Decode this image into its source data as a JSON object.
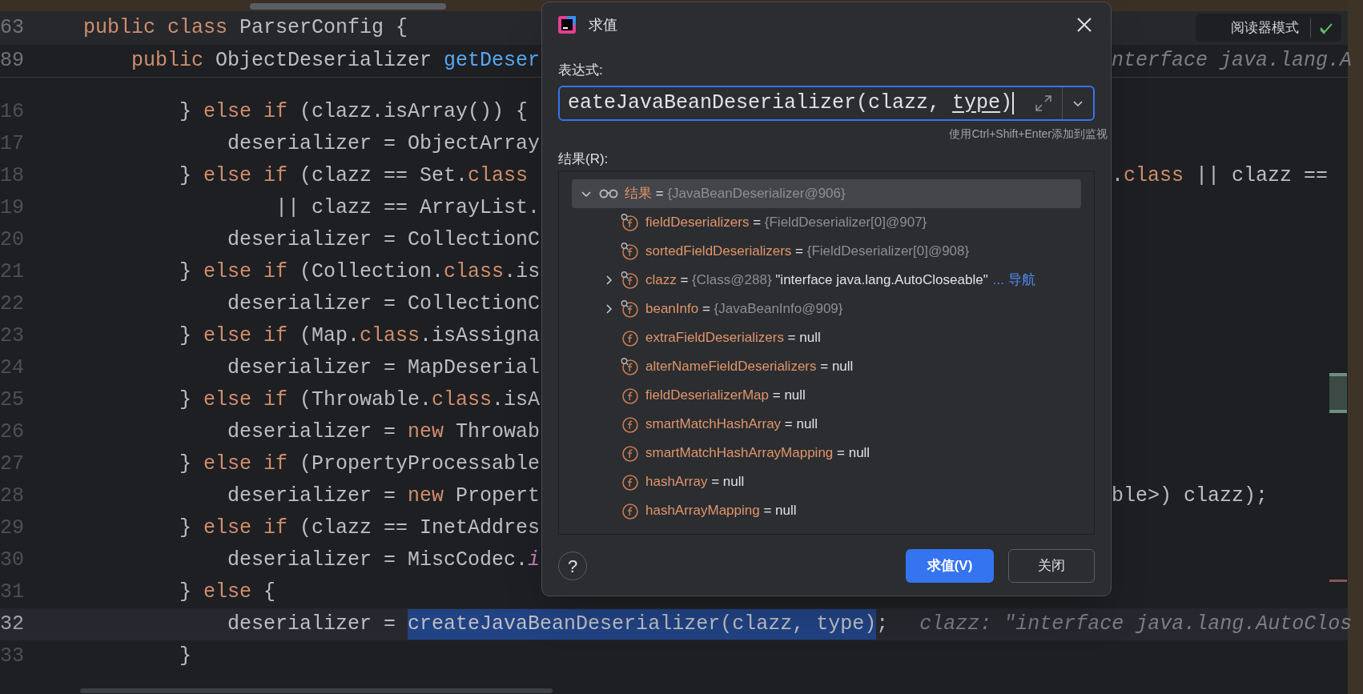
{
  "editor": {
    "sticky_lines": [
      {
        "number": "63",
        "tokens": [
          {
            "text": "public class",
            "kind": "keyword"
          },
          {
            "text": " ParserConfig {",
            "kind": "plain"
          }
        ]
      },
      {
        "number": "89",
        "tokens": [
          {
            "text": "    public",
            "kind": "keyword"
          },
          {
            "text": " ObjectDeserializer ",
            "kind": "plain"
          },
          {
            "text": "getDeser",
            "kind": "method"
          }
        ],
        "right_tokens": [
          {
            "text": "nterface java.lang.A",
            "kind": "hint"
          }
        ]
      }
    ],
    "reader_mode": {
      "label": "阅读器模式"
    },
    "lines": [
      {
        "number": "16",
        "current": false,
        "tokens": [
          {
            "text": "        } ",
            "kind": "plain"
          },
          {
            "text": "else if",
            "kind": "keyword"
          },
          {
            "text": " (clazz.isArray()) {",
            "kind": "plain"
          }
        ]
      },
      {
        "number": "17",
        "current": false,
        "tokens": [
          {
            "text": "            deserializer = ObjectArray",
            "kind": "plain"
          }
        ]
      },
      {
        "number": "18",
        "current": false,
        "tokens": [
          {
            "text": "        } ",
            "kind": "plain"
          },
          {
            "text": "else if",
            "kind": "keyword"
          },
          {
            "text": " (clazz == Set.",
            "kind": "plain"
          },
          {
            "text": "class",
            "kind": "keyword"
          }
        ],
        "right_tokens": [
          {
            "text": ".",
            "kind": "plain"
          },
          {
            "text": "class",
            "kind": "keyword"
          },
          {
            "text": " || clazz ==",
            "kind": "plain"
          }
        ]
      },
      {
        "number": "19",
        "current": false,
        "tokens": [
          {
            "text": "                || clazz == ArrayList.",
            "kind": "plain"
          }
        ]
      },
      {
        "number": "20",
        "current": false,
        "tokens": [
          {
            "text": "            deserializer = CollectionC",
            "kind": "plain"
          }
        ]
      },
      {
        "number": "21",
        "current": false,
        "tokens": [
          {
            "text": "        } ",
            "kind": "plain"
          },
          {
            "text": "else if",
            "kind": "keyword"
          },
          {
            "text": " (Collection.",
            "kind": "plain"
          },
          {
            "text": "class",
            "kind": "keyword"
          },
          {
            "text": ".is",
            "kind": "plain"
          }
        ]
      },
      {
        "number": "22",
        "current": false,
        "tokens": [
          {
            "text": "            deserializer = CollectionC",
            "kind": "plain"
          }
        ]
      },
      {
        "number": "23",
        "current": false,
        "tokens": [
          {
            "text": "        } ",
            "kind": "plain"
          },
          {
            "text": "else if",
            "kind": "keyword"
          },
          {
            "text": " (Map.",
            "kind": "plain"
          },
          {
            "text": "class",
            "kind": "keyword"
          },
          {
            "text": ".isAssigna",
            "kind": "plain"
          }
        ]
      },
      {
        "number": "24",
        "current": false,
        "tokens": [
          {
            "text": "            deserializer = MapDeserial",
            "kind": "plain"
          }
        ]
      },
      {
        "number": "25",
        "current": false,
        "tokens": [
          {
            "text": "        } ",
            "kind": "plain"
          },
          {
            "text": "else if",
            "kind": "keyword"
          },
          {
            "text": " (Throwable.",
            "kind": "plain"
          },
          {
            "text": "class",
            "kind": "keyword"
          },
          {
            "text": ".isA",
            "kind": "plain"
          }
        ]
      },
      {
        "number": "26",
        "current": false,
        "tokens": [
          {
            "text": "            deserializer = ",
            "kind": "plain"
          },
          {
            "text": "new",
            "kind": "keyword"
          },
          {
            "text": " Throwab",
            "kind": "plain"
          }
        ]
      },
      {
        "number": "27",
        "current": false,
        "tokens": [
          {
            "text": "        } ",
            "kind": "plain"
          },
          {
            "text": "else if",
            "kind": "keyword"
          },
          {
            "text": " (PropertyProcessable",
            "kind": "plain"
          }
        ]
      },
      {
        "number": "28",
        "current": false,
        "tokens": [
          {
            "text": "            deserializer = ",
            "kind": "plain"
          },
          {
            "text": "new",
            "kind": "keyword"
          },
          {
            "text": " Propert",
            "kind": "plain"
          }
        ],
        "right_tokens": [
          {
            "text": "ble>) clazz);",
            "kind": "plain"
          }
        ]
      },
      {
        "number": "29",
        "current": false,
        "tokens": [
          {
            "text": "        } ",
            "kind": "plain"
          },
          {
            "text": "else if",
            "kind": "keyword"
          },
          {
            "text": " (clazz == InetAddres",
            "kind": "plain"
          }
        ]
      },
      {
        "number": "30",
        "current": false,
        "tokens": [
          {
            "text": "            deserializer = MiscCodec.",
            "kind": "plain"
          },
          {
            "text": "i",
            "kind": "static"
          }
        ]
      },
      {
        "number": "31",
        "current": false,
        "tokens": [
          {
            "text": "        } ",
            "kind": "plain"
          },
          {
            "text": "else",
            "kind": "keyword"
          },
          {
            "text": " {",
            "kind": "plain"
          }
        ]
      },
      {
        "number": "32",
        "current": true,
        "tokens": [
          {
            "text": "            deserializer = ",
            "kind": "plain"
          },
          {
            "text": "createJavaBeanDeserializer(clazz, type)",
            "kind": "selected"
          },
          {
            "text": ";",
            "kind": "plain"
          },
          {
            "text": "clazz: \"interface java.lang.AutoClos",
            "kind": "hint"
          }
        ]
      },
      {
        "number": "33",
        "current": false,
        "tokens": [
          {
            "text": "        }",
            "kind": "plain"
          }
        ]
      }
    ]
  },
  "dialog": {
    "title": "求值",
    "expression_label": "表达式:",
    "expression": [
      {
        "text": "eateJavaBeanDeserializer(clazz, ",
        "kind": "plain"
      },
      {
        "text": "type",
        "kind": "underlined"
      },
      {
        "text": ")",
        "kind": "plain"
      }
    ],
    "hint": "使用Ctrl+Shift+Enter添加到监视",
    "result_label": "结果(R):",
    "result_tree": {
      "name": "结果",
      "op": "=",
      "value": "{JavaBeanDeserializer@906}",
      "expanded": true,
      "selected": true,
      "children": [
        {
          "name": "fieldDeserializers",
          "op": "=",
          "marked": true,
          "expandable": false,
          "value": [
            {
              "text": "{FieldDeserializer[0]@907}",
              "kind": "ref"
            }
          ]
        },
        {
          "name": "sortedFieldDeserializers",
          "op": "=",
          "marked": true,
          "expandable": false,
          "value": [
            {
              "text": "{FieldDeserializer[0]@908}",
              "kind": "ref"
            }
          ]
        },
        {
          "name": "clazz",
          "op": "=",
          "marked": true,
          "expandable": true,
          "value": [
            {
              "text": "{Class@288}",
              "kind": "ref"
            },
            {
              "text": "\"interface java.lang.AutoCloseable\"",
              "kind": "literal"
            },
            {
              "text": "... 导航",
              "kind": "link"
            }
          ]
        },
        {
          "name": "beanInfo",
          "op": "=",
          "marked": true,
          "expandable": true,
          "value": [
            {
              "text": "{JavaBeanInfo@909}",
              "kind": "ref"
            }
          ]
        },
        {
          "name": "extraFieldDeserializers",
          "op": "=",
          "marked": false,
          "expandable": false,
          "value": [
            {
              "text": "null",
              "kind": "literal"
            }
          ]
        },
        {
          "name": "alterNameFieldDeserializers",
          "op": "=",
          "marked": true,
          "expandable": false,
          "value": [
            {
              "text": "null",
              "kind": "literal"
            }
          ]
        },
        {
          "name": "fieldDeserializerMap",
          "op": "=",
          "marked": false,
          "expandable": false,
          "value": [
            {
              "text": "null",
              "kind": "literal"
            }
          ]
        },
        {
          "name": "smartMatchHashArray",
          "op": "=",
          "marked": false,
          "expandable": false,
          "value": [
            {
              "text": "null",
              "kind": "literal"
            }
          ]
        },
        {
          "name": "smartMatchHashArrayMapping",
          "op": "=",
          "marked": false,
          "expandable": false,
          "value": [
            {
              "text": "null",
              "kind": "literal"
            }
          ]
        },
        {
          "name": "hashArray",
          "op": "=",
          "marked": false,
          "expandable": false,
          "value": [
            {
              "text": "null",
              "kind": "literal"
            }
          ]
        },
        {
          "name": "hashArrayMapping",
          "op": "=",
          "marked": false,
          "expandable": false,
          "value": [
            {
              "text": "null",
              "kind": "literal"
            }
          ]
        }
      ]
    },
    "help": "?",
    "buttons": [
      {
        "label": "求值(V)",
        "primary": true
      },
      {
        "label": "关闭",
        "primary": false
      }
    ]
  }
}
